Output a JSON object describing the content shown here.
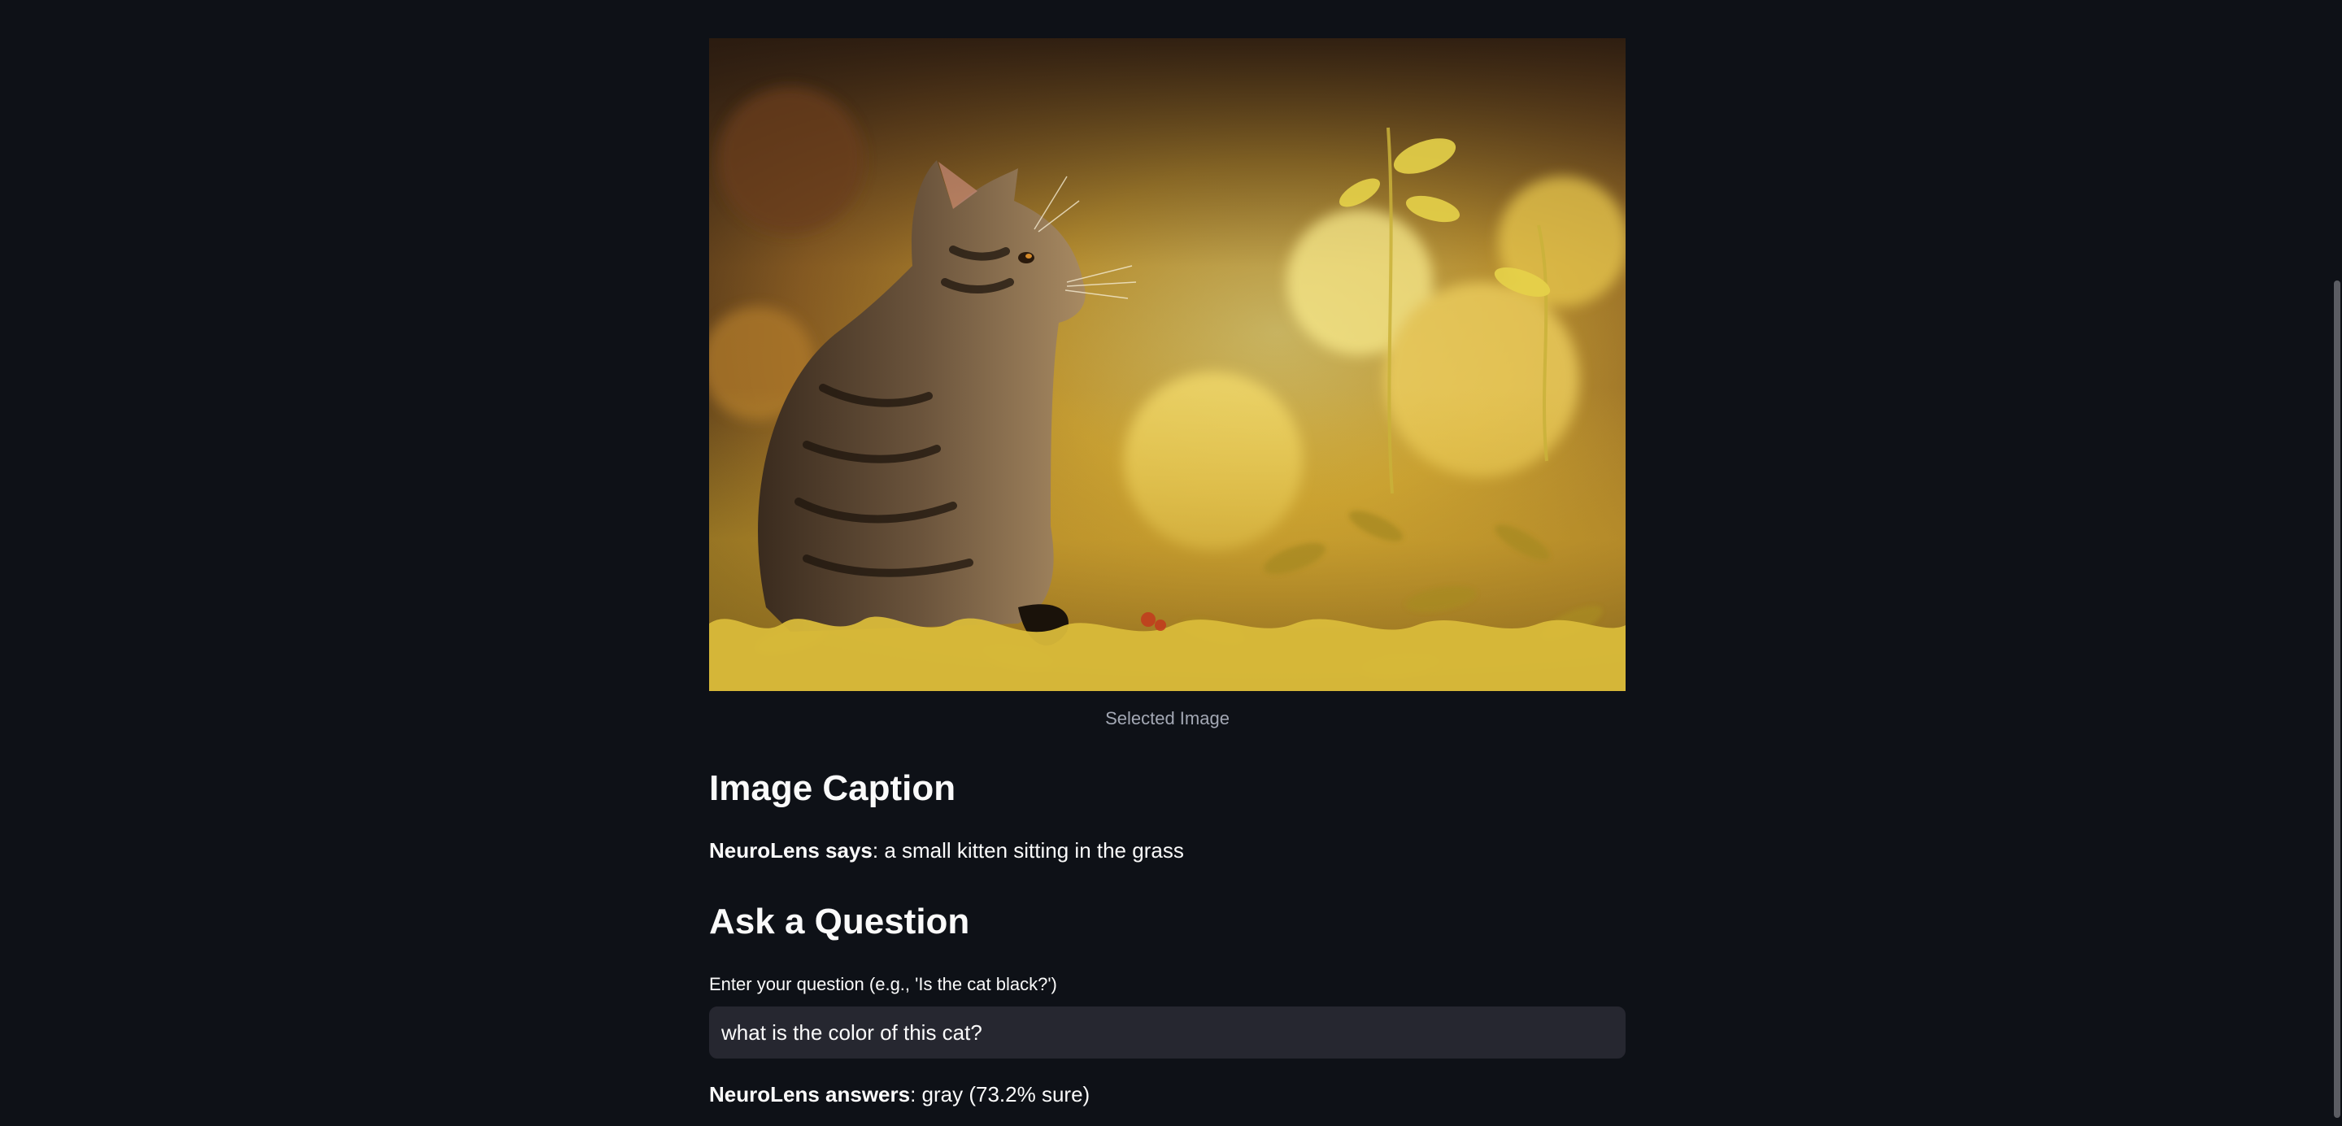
{
  "image": {
    "caption": "Selected Image",
    "subject": "kitten-in-grass-photo"
  },
  "caption_section": {
    "heading": "Image Caption",
    "prefix": "NeuroLens says",
    "text": ": a small kitten sitting in the grass"
  },
  "question_section": {
    "heading": "Ask a Question",
    "input_label": "Enter your question (e.g., 'Is the cat black?')",
    "input_value": "what is the color of this cat?",
    "answer_prefix": "NeuroLens answers",
    "answer_text": ": gray (73.2% sure)"
  },
  "colors": {
    "background": "#0e1117",
    "input_background": "#262730",
    "caption_text": "#a3a8b4"
  }
}
